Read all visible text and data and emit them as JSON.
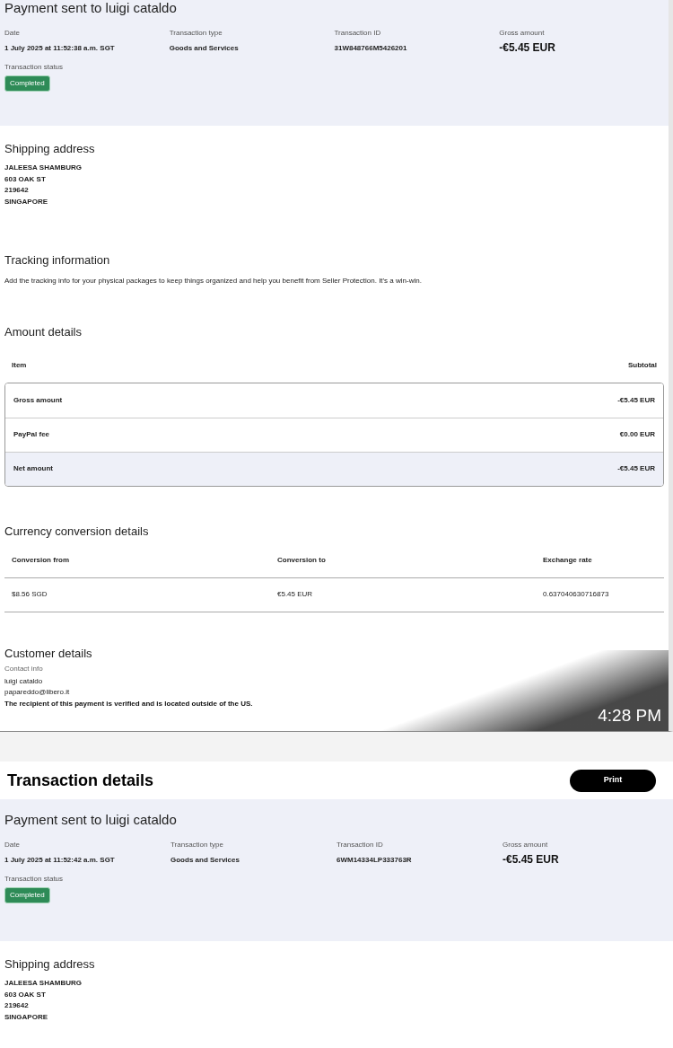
{
  "screenshots": [
    {
      "summary": {
        "title": "Payment sent to luigi cataldo",
        "fields": [
          {
            "label": "Date",
            "value": "1 July 2025 at 11:52:38 a.m. SGT",
            "kind": "text"
          },
          {
            "label": "Transaction type",
            "value": "Goods and Services",
            "kind": "text"
          },
          {
            "label": "Transaction ID",
            "value": "31W848766M5426201",
            "kind": "text"
          },
          {
            "label": "Gross amount",
            "value": "-€5.45 EUR",
            "kind": "amount"
          }
        ],
        "status_label": "Transaction status",
        "status": "Completed"
      },
      "shipping": {
        "heading": "Shipping address",
        "lines": [
          "JALEESA SHAMBURG",
          "603 OAK ST",
          "219642",
          "SINGAPORE"
        ]
      },
      "tracking": {
        "heading": "Tracking information",
        "text": "Add the tracking info for your physical packages to keep things organized and help you benefit from Seller Protection. It's a win-win."
      },
      "amount_details": {
        "heading": "Amount details",
        "columns": [
          "Item",
          "Subtotal"
        ],
        "rows": [
          {
            "item": "Gross amount",
            "subtotal": "-€5.45 EUR",
            "highlighted": false
          },
          {
            "item": "PayPal fee",
            "subtotal": "€0.00 EUR",
            "highlighted": false
          },
          {
            "item": "Net amount",
            "subtotal": "-€5.45 EUR",
            "highlighted": true
          }
        ]
      },
      "currency": {
        "heading": "Currency conversion details",
        "columns": [
          "Conversion from",
          "Conversion to",
          "Exchange rate"
        ],
        "row": [
          "$8.56 SGD",
          "€5.45 EUR",
          "0.637040630716873"
        ]
      },
      "customer": {
        "heading": "Customer details",
        "label": "Contact info",
        "lines": [
          "luigi cataldo",
          "papareddo@libero.it"
        ],
        "note": "The recipient of this payment is verified and is located outside of the US."
      },
      "timestamp": "4:28 PM"
    },
    {
      "header": {
        "title": "Transaction details",
        "button": "Print"
      },
      "summary": {
        "title": "Payment sent to luigi cataldo",
        "fields": [
          {
            "label": "Date",
            "value": "1 July 2025 at 11:52:42 a.m. SGT",
            "kind": "text"
          },
          {
            "label": "Transaction type",
            "value": "Goods and Services",
            "kind": "text"
          },
          {
            "label": "Transaction ID",
            "value": "6WM14334LP333763R",
            "kind": "text"
          },
          {
            "label": "Gross amount",
            "value": "-€5.45 EUR",
            "kind": "amount"
          }
        ],
        "status_label": "Transaction status",
        "status": "Completed"
      },
      "shipping": {
        "heading": "Shipping address",
        "lines": [
          "JALEESA SHAMBURG",
          "603 OAK ST",
          "219642",
          "SINGAPORE"
        ]
      }
    }
  ]
}
